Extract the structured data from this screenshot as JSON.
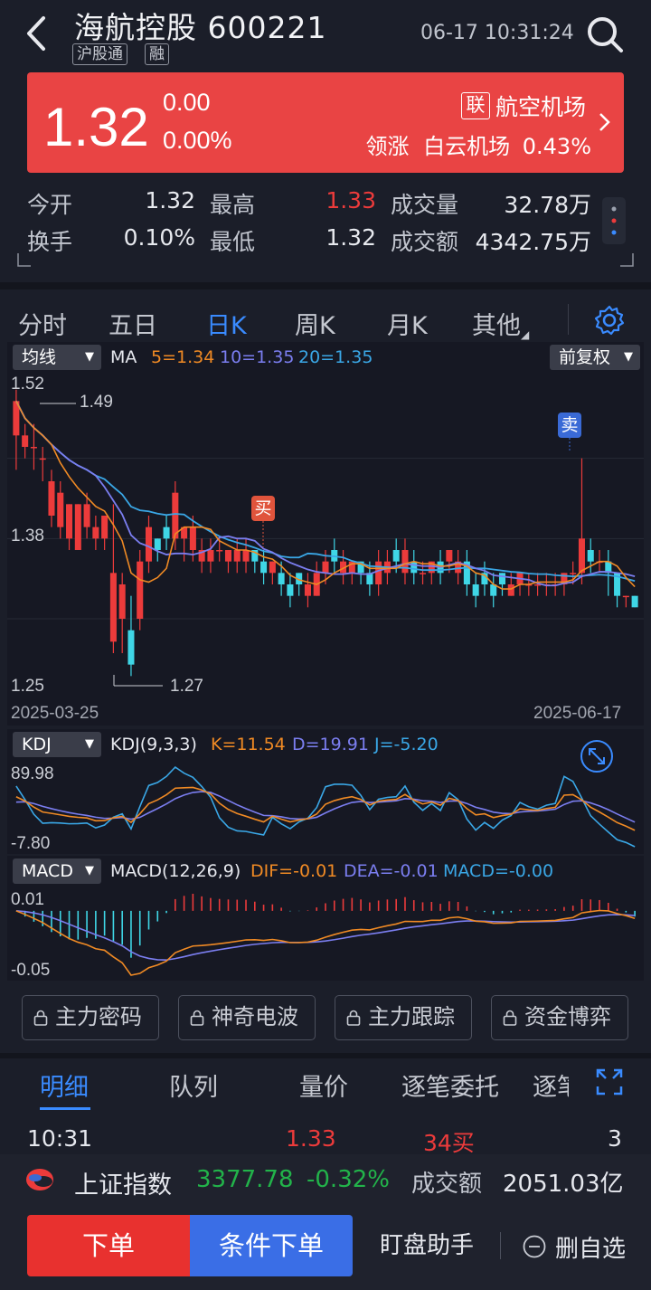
{
  "header": {
    "title": "海航控股 600221",
    "tags": [
      "沪股通",
      "融"
    ],
    "datetime": "06-17 10:31:24"
  },
  "quote": {
    "price": "1.32",
    "change": "0.00",
    "change_pct": "0.00%",
    "lian_badge": "联",
    "sector": "航空机场",
    "leader_label": "领涨",
    "leader_name": "白云机场",
    "leader_pct": "0.43%"
  },
  "stats": {
    "open_label": "今开",
    "open": "1.32",
    "high_label": "最高",
    "high": "1.33",
    "volume_label": "成交量",
    "volume": "32.78万",
    "turnover_label": "换手",
    "turnover": "0.10%",
    "low_label": "最低",
    "low": "1.32",
    "amount_label": "成交额",
    "amount": "4342.75万"
  },
  "period_tabs": [
    "分时",
    "五日",
    "日K",
    "周K",
    "月K",
    "其他"
  ],
  "active_period": "日K",
  "kline": {
    "indicator_dropdown": "均线",
    "adjust_dropdown": "前复权",
    "ma_label": "MA",
    "ma5": "5=1.34",
    "ma10": "10=1.35",
    "ma20": "20=1.35",
    "y_top": "1.52",
    "y_mid": "1.38",
    "y_bottom": "1.25",
    "high_mark": "1.49",
    "low_mark": "1.27",
    "date_start": "2025-03-25",
    "date_end": "2025-06-17",
    "buy_signal": "买",
    "sell_signal": "卖"
  },
  "kdj": {
    "dropdown": "KDJ",
    "params": "KDJ(9,3,3)",
    "k": "K=11.54",
    "d": "D=19.91",
    "j": "J=-5.20",
    "y_top": "89.98",
    "y_bottom": "-7.80"
  },
  "macd": {
    "dropdown": "MACD",
    "params": "MACD(12,26,9)",
    "dif": "DIF=-0.01",
    "dea": "DEA=-0.01",
    "macd": "MACD=-0.00",
    "y_top": "0.01",
    "y_bottom": "-0.05"
  },
  "tools": [
    "主力密码",
    "神奇电波",
    "主力跟踪",
    "资金博弈"
  ],
  "detail_tabs": [
    "明细",
    "队列",
    "量价",
    "逐笔委托",
    "逐笔"
  ],
  "detail_row": {
    "time": "10:31",
    "price": "1.33",
    "volume": "34买",
    "count": "3"
  },
  "index_bar": {
    "name": "上证指数",
    "value": "3377.78",
    "change_pct": "-0.32%",
    "amount_label": "成交额",
    "amount": "2051.03亿"
  },
  "actions": {
    "order": "下单",
    "conditional_order": "条件下单",
    "assistant": "盯盘助手",
    "remove_fav": "删自选"
  },
  "colors": {
    "up": "#ec3b3b",
    "down": "#3fd6e6",
    "accent": "#3a8bff",
    "ma5": "#f08a24",
    "ma10": "#7b7ef0",
    "ma20": "#3aa7e6"
  },
  "chart_data": [
    {
      "type": "candlestick",
      "title": "日K",
      "x_range": [
        "2025-03-25",
        "2025-06-17"
      ],
      "ylim": [
        1.25,
        1.52
      ],
      "y_ticks": [
        1.52,
        1.38,
        1.25
      ],
      "annotations": [
        {
          "label": "1.49",
          "kind": "high"
        },
        {
          "label": "1.27",
          "kind": "low"
        },
        {
          "label": "买"
        },
        {
          "label": "卖"
        }
      ],
      "candles": [
        [
          1.47,
          1.5,
          1.44,
          1.51
        ],
        [
          1.46,
          1.47,
          1.45,
          1.48
        ],
        [
          1.46,
          1.46,
          1.44,
          1.48
        ],
        [
          1.45,
          1.45,
          1.43,
          1.46
        ],
        [
          1.4,
          1.43,
          1.39,
          1.44
        ],
        [
          1.39,
          1.42,
          1.38,
          1.43
        ],
        [
          1.38,
          1.41,
          1.37,
          1.41
        ],
        [
          1.37,
          1.41,
          1.37,
          1.41
        ],
        [
          1.39,
          1.41,
          1.38,
          1.42
        ],
        [
          1.38,
          1.39,
          1.37,
          1.4
        ],
        [
          1.38,
          1.4,
          1.37,
          1.4
        ],
        [
          1.29,
          1.35,
          1.28,
          1.41
        ],
        [
          1.31,
          1.34,
          1.28,
          1.35
        ],
        [
          1.3,
          1.27,
          1.26,
          1.33
        ],
        [
          1.31,
          1.36,
          1.3,
          1.37
        ],
        [
          1.36,
          1.39,
          1.35,
          1.4
        ],
        [
          1.38,
          1.37,
          1.36,
          1.38
        ],
        [
          1.39,
          1.38,
          1.37,
          1.4
        ],
        [
          1.38,
          1.42,
          1.37,
          1.43
        ],
        [
          1.38,
          1.39,
          1.36,
          1.39
        ],
        [
          1.37,
          1.39,
          1.36,
          1.4
        ],
        [
          1.36,
          1.37,
          1.35,
          1.38
        ],
        [
          1.36,
          1.37,
          1.35,
          1.38
        ],
        [
          1.37,
          1.37,
          1.36,
          1.38
        ],
        [
          1.36,
          1.37,
          1.35,
          1.37
        ],
        [
          1.36,
          1.37,
          1.35,
          1.38
        ],
        [
          1.36,
          1.37,
          1.35,
          1.38
        ],
        [
          1.37,
          1.36,
          1.35,
          1.37
        ],
        [
          1.36,
          1.35,
          1.34,
          1.37
        ],
        [
          1.35,
          1.36,
          1.34,
          1.36
        ],
        [
          1.35,
          1.34,
          1.33,
          1.36
        ],
        [
          1.34,
          1.33,
          1.32,
          1.35
        ],
        [
          1.35,
          1.34,
          1.33,
          1.35
        ],
        [
          1.33,
          1.34,
          1.32,
          1.35
        ],
        [
          1.33,
          1.35,
          1.33,
          1.36
        ],
        [
          1.35,
          1.36,
          1.34,
          1.37
        ],
        [
          1.37,
          1.36,
          1.35,
          1.38
        ],
        [
          1.35,
          1.36,
          1.34,
          1.37
        ],
        [
          1.35,
          1.36,
          1.34,
          1.36
        ],
        [
          1.36,
          1.35,
          1.34,
          1.36
        ],
        [
          1.35,
          1.34,
          1.33,
          1.36
        ],
        [
          1.34,
          1.36,
          1.33,
          1.37
        ],
        [
          1.35,
          1.36,
          1.34,
          1.37
        ],
        [
          1.37,
          1.36,
          1.35,
          1.38
        ],
        [
          1.35,
          1.37,
          1.34,
          1.38
        ],
        [
          1.36,
          1.35,
          1.34,
          1.37
        ],
        [
          1.35,
          1.35,
          1.34,
          1.36
        ],
        [
          1.35,
          1.36,
          1.34,
          1.36
        ],
        [
          1.36,
          1.35,
          1.34,
          1.37
        ],
        [
          1.36,
          1.37,
          1.35,
          1.37
        ],
        [
          1.35,
          1.36,
          1.34,
          1.37
        ],
        [
          1.36,
          1.34,
          1.33,
          1.37
        ],
        [
          1.34,
          1.33,
          1.32,
          1.35
        ],
        [
          1.35,
          1.34,
          1.33,
          1.36
        ],
        [
          1.34,
          1.33,
          1.32,
          1.35
        ],
        [
          1.35,
          1.34,
          1.33,
          1.35
        ],
        [
          1.33,
          1.34,
          1.33,
          1.35
        ],
        [
          1.34,
          1.35,
          1.33,
          1.35
        ],
        [
          1.34,
          1.34,
          1.33,
          1.35
        ],
        [
          1.34,
          1.34,
          1.33,
          1.35
        ],
        [
          1.34,
          1.34,
          1.33,
          1.35
        ],
        [
          1.34,
          1.34,
          1.33,
          1.35
        ],
        [
          1.34,
          1.35,
          1.33,
          1.35
        ],
        [
          1.35,
          1.35,
          1.34,
          1.36
        ],
        [
          1.35,
          1.38,
          1.34,
          1.45
        ],
        [
          1.37,
          1.36,
          1.35,
          1.38
        ],
        [
          1.36,
          1.36,
          1.35,
          1.37
        ],
        [
          1.36,
          1.35,
          1.33,
          1.37
        ],
        [
          1.35,
          1.33,
          1.32,
          1.35
        ],
        [
          1.33,
          1.33,
          1.32,
          1.33
        ],
        [
          1.33,
          1.32,
          1.32,
          1.33
        ]
      ],
      "candle_format": [
        "open",
        "close",
        "low",
        "high"
      ],
      "series": [
        {
          "name": "MA5",
          "last": 1.34
        },
        {
          "name": "MA10",
          "last": 1.35
        },
        {
          "name": "MA20",
          "last": 1.35
        }
      ]
    },
    {
      "type": "line",
      "title": "KDJ(9,3,3)",
      "ylim": [
        -7.8,
        89.98
      ],
      "series": [
        {
          "name": "K",
          "last": 11.54
        },
        {
          "name": "D",
          "last": 19.91
        },
        {
          "name": "J",
          "last": -5.2
        }
      ]
    },
    {
      "type": "bar",
      "title": "MACD(12,26,9)",
      "ylim": [
        -0.05,
        0.01
      ],
      "series": [
        {
          "name": "DIF",
          "last": -0.01
        },
        {
          "name": "DEA",
          "last": -0.01
        },
        {
          "name": "MACD",
          "last": -0.0
        }
      ]
    }
  ]
}
